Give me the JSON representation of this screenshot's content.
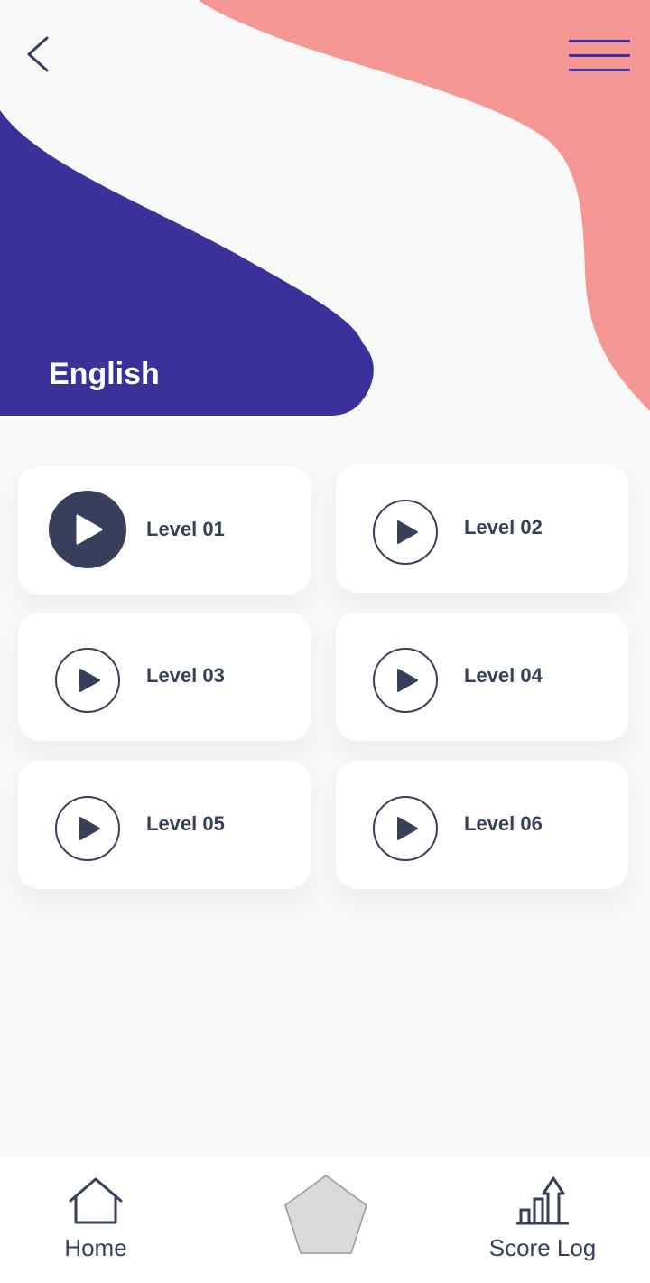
{
  "colors": {
    "background": "#f8f8f8",
    "indigo_blob": "#3c309b",
    "coral_blob": "#f49694",
    "dark_navy": "#373f5a",
    "menu_icon": "#3c309b",
    "card": "#ffffff"
  },
  "header": {
    "back_icon": "chevron-left-icon",
    "menu_icon": "hamburger-menu-icon",
    "title": "English"
  },
  "levels": [
    {
      "label": "Level 01",
      "icon": "play-filled-icon",
      "active": true
    },
    {
      "label": "Level 02",
      "icon": "play-outline-icon",
      "active": false
    },
    {
      "label": "Level 03",
      "icon": "play-outline-icon",
      "active": false
    },
    {
      "label": "Level 04",
      "icon": "play-outline-icon",
      "active": false
    },
    {
      "label": "Level 05",
      "icon": "play-outline-icon",
      "active": false
    },
    {
      "label": "Level 06",
      "icon": "play-outline-icon",
      "active": false
    }
  ],
  "bottom_nav": {
    "home": {
      "label": "Home",
      "icon": "home-icon"
    },
    "center": {
      "icon": "pentagon-icon"
    },
    "score_log": {
      "label": "Score Log",
      "icon": "bar-chart-up-icon"
    }
  }
}
